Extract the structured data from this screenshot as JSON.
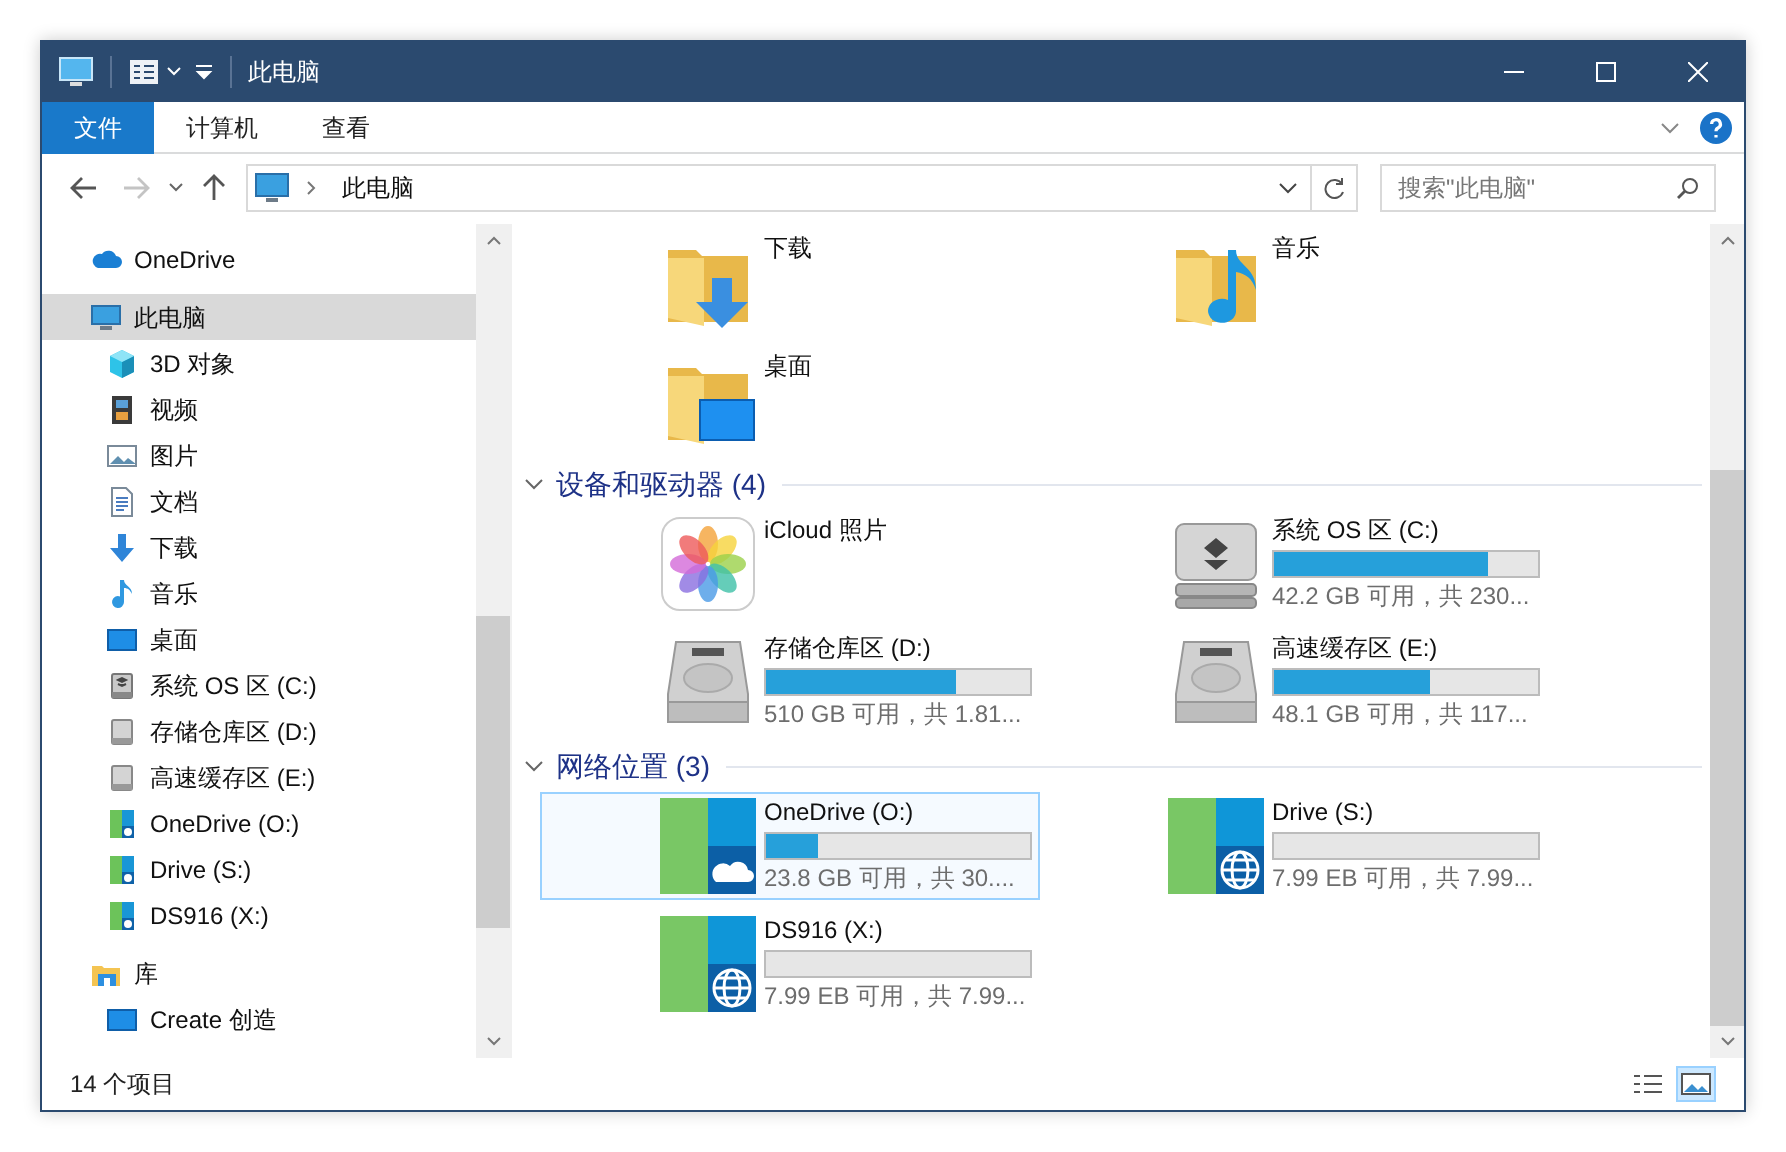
{
  "window": {
    "title": "此电脑"
  },
  "ribbon": {
    "tabs": [
      {
        "label": "文件",
        "kind": "file"
      },
      {
        "label": "计算机",
        "kind": "tab"
      },
      {
        "label": "查看",
        "kind": "tab"
      }
    ]
  },
  "nav": {
    "back": {
      "disabled": false
    },
    "forward": {
      "disabled": true
    }
  },
  "address": {
    "path": "此电脑"
  },
  "search": {
    "placeholder": "搜索\"此电脑\""
  },
  "sidebar": {
    "items": [
      {
        "label": "OneDrive",
        "kind": "cloud",
        "selected": false
      },
      {
        "label": "此电脑",
        "kind": "pc",
        "selected": true,
        "children": [
          {
            "label": "3D 对象",
            "kind": "cube",
            "selected": false
          },
          {
            "label": "视频",
            "kind": "video",
            "selected": false
          },
          {
            "label": "图片",
            "kind": "picture",
            "selected": false
          },
          {
            "label": "文档",
            "kind": "document",
            "selected": false
          },
          {
            "label": "下载",
            "kind": "download",
            "selected": false
          },
          {
            "label": "音乐",
            "kind": "music",
            "selected": false
          },
          {
            "label": "桌面",
            "kind": "desktop",
            "selected": false
          },
          {
            "label": "系统 OS 区 (C:)",
            "kind": "system-disk",
            "selected": false
          },
          {
            "label": "存储仓库区 (D:)",
            "kind": "disk",
            "selected": false
          },
          {
            "label": "高速缓存区 (E:)",
            "kind": "disk",
            "selected": false
          },
          {
            "label": "OneDrive (O:)",
            "kind": "net",
            "selected": false
          },
          {
            "label": "Drive (S:)",
            "kind": "net",
            "selected": false
          },
          {
            "label": "DS916 (X:)",
            "kind": "net",
            "selected": false
          }
        ]
      },
      {
        "label": "库",
        "kind": "library",
        "selected": false,
        "children": [
          {
            "label": "Create 创造",
            "kind": "desktop",
            "selected": false
          }
        ]
      }
    ]
  },
  "content": {
    "sections": [
      {
        "items": [
          {
            "name": "下载",
            "kind": "folder-download",
            "selected": false
          },
          {
            "name": "音乐",
            "kind": "folder-music",
            "selected": false
          },
          {
            "name": "桌面",
            "kind": "folder-desktop",
            "selected": false
          }
        ]
      },
      {
        "title": "设备和驱动器 (4)",
        "expanded": true,
        "items": [
          {
            "name": "iCloud 照片",
            "kind": "photos",
            "selected": false
          },
          {
            "name": "系统 OS 区 (C:)",
            "kind": "system-disk",
            "selected": false,
            "level": 0.81,
            "detail": "42.2 GB 可用，共 230..."
          },
          {
            "name": "存储仓库区 (D:)",
            "kind": "disk",
            "selected": false,
            "level": 0.72,
            "detail": "510 GB 可用，共 1.81..."
          },
          {
            "name": "高速缓存区 (E:)",
            "kind": "disk",
            "selected": false,
            "level": 0.59,
            "detail": "48.1 GB 可用，共 117..."
          }
        ]
      },
      {
        "title": "网络位置 (3)",
        "expanded": true,
        "items": [
          {
            "name": "OneDrive (O:)",
            "kind": "cloud-drive",
            "selected": true,
            "level": 0.2,
            "detail": "23.8 GB 可用，共 30...."
          },
          {
            "name": "Drive (S:)",
            "kind": "network-drive",
            "selected": false,
            "level": 0,
            "detail": "7.99 EB 可用，共 7.99..."
          },
          {
            "name": "DS916 (X:)",
            "kind": "network-drive",
            "selected": false,
            "level": 0,
            "detail": "7.99 EB 可用，共 7.99..."
          }
        ]
      }
    ]
  },
  "status_bar": {
    "item_count": "14 个项目",
    "views": [
      {
        "kind": "details",
        "selected": false
      },
      {
        "kind": "tiles",
        "selected": true
      }
    ]
  }
}
